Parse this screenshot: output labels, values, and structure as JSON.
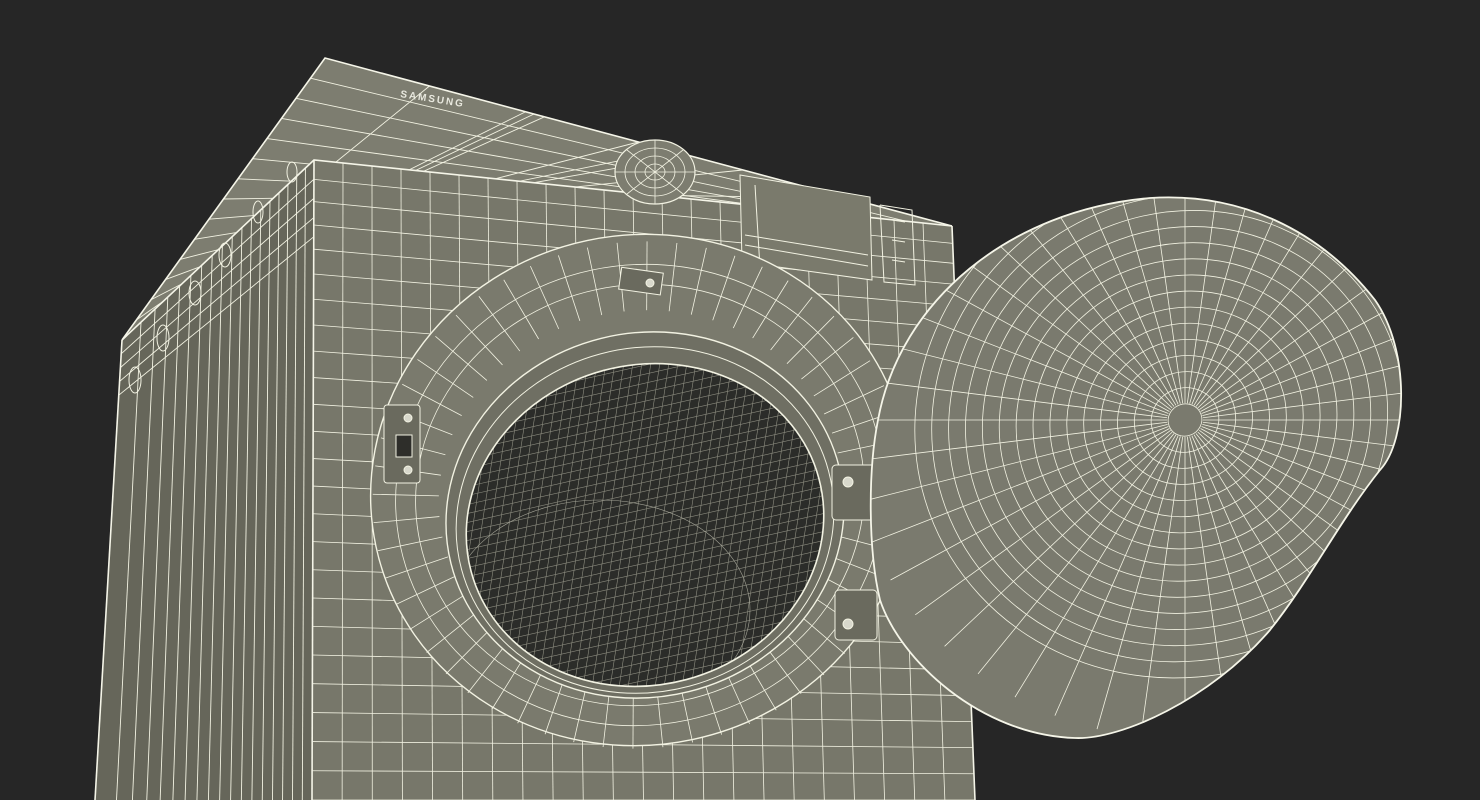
{
  "scene": {
    "background_color": "#262626",
    "body_color": "#77776a",
    "body_dark_color": "#5f5f54",
    "wire_color": "#f2f2e2",
    "drum_color": "#2a2b28",
    "door_color": "#7a7a6e"
  },
  "machine": {
    "brand_label": "SAMSUNG"
  }
}
